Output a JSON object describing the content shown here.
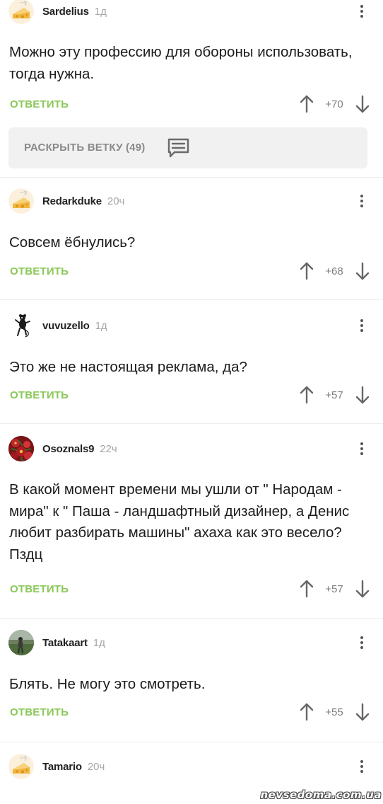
{
  "comments": [
    {
      "username": "Sardelius",
      "time": "1д",
      "avatar_icon": "cheese-avatar-icon",
      "text": "Можно эту профессию для обороны использовать, тогда нужна.",
      "reply_label": "ОТВЕТИТЬ",
      "rating": "+70"
    },
    {
      "username": "Redarkduke",
      "time": "20ч",
      "avatar_icon": "cheese-avatar-icon",
      "text": "Совсем ёбнулись?",
      "reply_label": "ОТВЕТИТЬ",
      "rating": "+68"
    },
    {
      "username": "vuvuzello",
      "time": "1д",
      "avatar_icon": "rat-avatar-icon",
      "text": "Это же не настоящая реклама, да?",
      "reply_label": "ОТВЕТИТЬ",
      "rating": "+57"
    },
    {
      "username": "Osoznals9",
      "time": "22ч",
      "avatar_icon": "red-flowers-avatar",
      "text": "В какой момент времени мы ушли от \" Народам - мира\" к \" Паша - ландшафтный дизайнер, а Денис любит разбирать машины\" ахаха как это весело? Пздц",
      "reply_label": "ОТВЕТИТЬ",
      "rating": "+57"
    },
    {
      "username": "Tatakaart",
      "time": "1д",
      "avatar_icon": "photo-avatar",
      "text": "Блять. Не могу это смотреть.",
      "reply_label": "ОТВЕТИТЬ",
      "rating": "+55"
    },
    {
      "username": "Tamario",
      "time": "20ч",
      "avatar_icon": "cheese-avatar-icon"
    }
  ],
  "expand_thread": {
    "label": "РАСКРЫТЬ ВЕТКУ (49)",
    "icon": "comment-lines-icon"
  },
  "watermark": "nevsedoma.com.ua",
  "colors": {
    "reply_green": "#8ac858",
    "username": "#222222",
    "time_gray": "#a6a6a6",
    "rating_gray": "#7d7d7d",
    "expand_bg": "#f1f1f1"
  }
}
